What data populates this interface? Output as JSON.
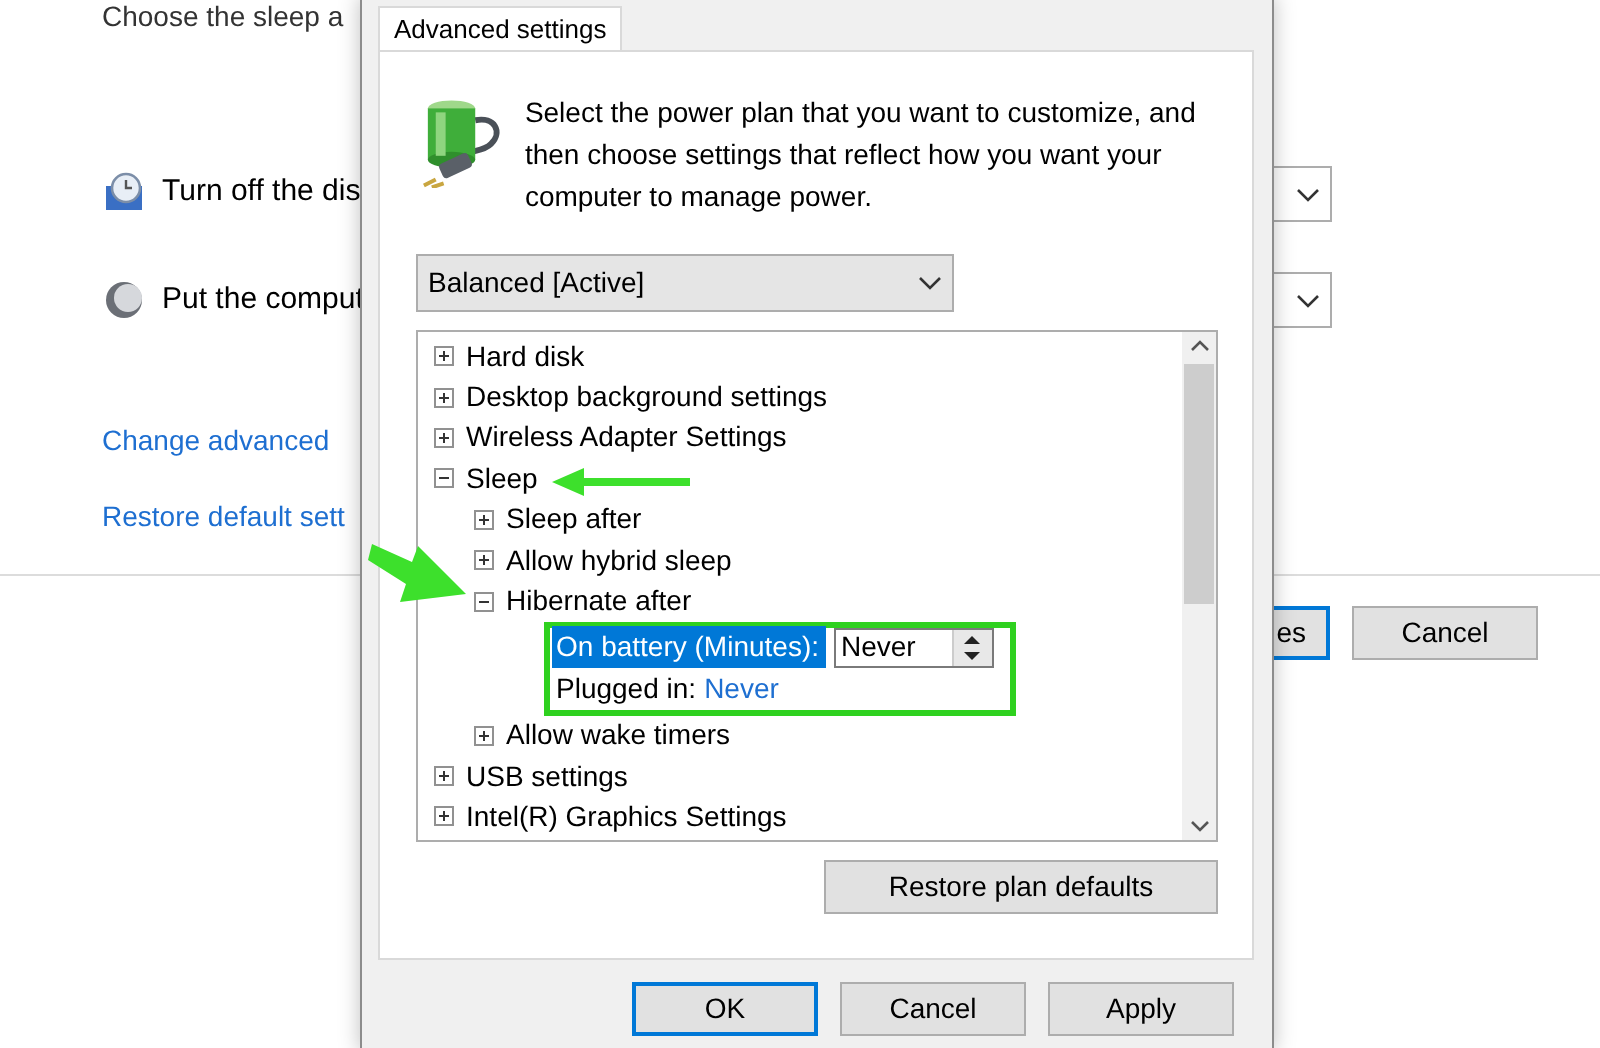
{
  "background_window": {
    "heading": "Choose the sleep a",
    "settings": [
      {
        "kind": "display",
        "label": "Turn off the dis"
      },
      {
        "kind": "moon",
        "label": "Put the comput"
      }
    ],
    "links": [
      "Change advanced",
      "Restore default sett"
    ],
    "buttons": [
      {
        "label": "es",
        "default": true
      },
      {
        "label": "Cancel",
        "default": false
      }
    ]
  },
  "dialog": {
    "tabs": [
      {
        "label": "Advanced settings",
        "selected": true
      }
    ],
    "intro": "Select the power plan that you want to customize, and then choose settings that reflect how you want your computer to manage power.",
    "plan": "Balanced [Active]",
    "tree": [
      {
        "label": "Hard disk",
        "expanded": false
      },
      {
        "label": "Desktop background settings",
        "expanded": false
      },
      {
        "label": "Wireless Adapter Settings",
        "expanded": false
      },
      {
        "label": "Sleep",
        "expanded": true,
        "children": [
          {
            "label": "Sleep after",
            "expanded": false
          },
          {
            "label": "Allow hybrid sleep",
            "expanded": false
          },
          {
            "label": "Hibernate after",
            "expanded": true,
            "settings": [
              {
                "kind": "spin",
                "label": "On battery (Minutes):",
                "value": "Never",
                "selected": true
              },
              {
                "kind": "link",
                "label": "Plugged in:",
                "value": "Never",
                "selected": false
              }
            ]
          },
          {
            "label": "Allow wake timers",
            "expanded": false
          }
        ]
      },
      {
        "label": "USB settings",
        "expanded": false
      },
      {
        "label": "Intel(R) Graphics Settings",
        "expanded": false
      }
    ],
    "restore_button": "Restore plan defaults",
    "buttons": [
      {
        "label": "OK",
        "default": true
      },
      {
        "label": "Cancel",
        "default": false
      },
      {
        "label": "Apply",
        "default": false
      }
    ]
  }
}
